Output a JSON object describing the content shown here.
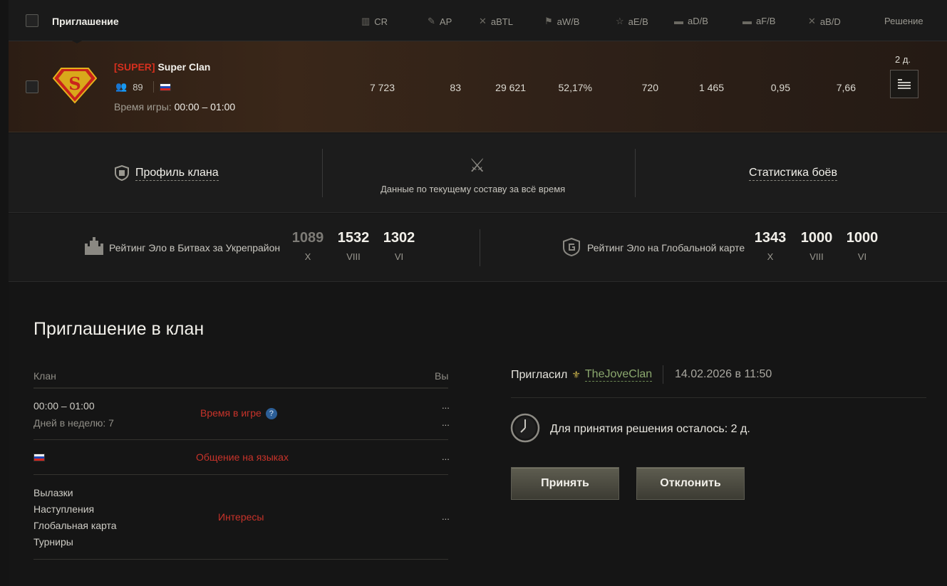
{
  "header": {
    "title": "Приглашение",
    "columns": [
      {
        "label": "CR",
        "icon": "cr-icon"
      },
      {
        "label": "AP",
        "icon": "ap-icon"
      },
      {
        "label": "aBTL",
        "icon": "battles-icon"
      },
      {
        "label": "aW/B",
        "icon": "wins-icon"
      },
      {
        "label": "aE/B",
        "icon": "exp-icon"
      },
      {
        "label": "aD/B",
        "icon": "damage-icon"
      },
      {
        "label": "aF/B",
        "icon": "frags-icon"
      },
      {
        "label": "aB/D",
        "icon": "ratio-icon"
      }
    ],
    "decision": "Решение"
  },
  "clan": {
    "tag": "[SUPER]",
    "name": "Super Clan",
    "members": "89",
    "playtime_label": "Время игры:",
    "playtime_value": "00:00 – 01:00",
    "values": [
      "7 723",
      "83",
      "29 621",
      "52,17%",
      "720",
      "1 465",
      "0,95",
      "7,66"
    ],
    "days_left": "2 д."
  },
  "profile": {
    "clan_profile": "Профиль клана",
    "subtitle": "Данные по текущему составу за всё время",
    "battle_stats": "Статистика боёв"
  },
  "elo": {
    "stronghold_label": "Рейтинг Эло в Битвах за Укрепрайон",
    "stronghold": [
      {
        "value": "1089",
        "tier": "X"
      },
      {
        "value": "1532",
        "tier": "VIII"
      },
      {
        "value": "1302",
        "tier": "VI"
      }
    ],
    "globalmap_label": "Рейтинг Эло на Глобальной карте",
    "globalmap": [
      {
        "value": "1343",
        "tier": "X"
      },
      {
        "value": "1000",
        "tier": "VIII"
      },
      {
        "value": "1000",
        "tier": "VI"
      }
    ]
  },
  "invitation": {
    "title": "Приглашение в клан",
    "col_clan": "Клан",
    "col_you": "Вы",
    "time": "00:00 – 01:00",
    "days": "Дней в неделю: 7",
    "time_label": "Время в игре",
    "lang_label": "Общение на языках",
    "interests": [
      "Вылазки",
      "Наступления",
      "Глобальная карта",
      "Турниры"
    ],
    "interests_label": "Интересы",
    "dots": "...",
    "invited_by_label": "Пригласил",
    "invited_by": "TheJoveClan",
    "date": "14.02.2026 в 11:50",
    "remaining": "Для принятия решения осталось: 2 д.",
    "accept": "Принять",
    "decline": "Отклонить"
  },
  "colors": {
    "accent_red": "#d6301e",
    "player_green": "#8ba86e",
    "button": "#4d4c42"
  }
}
